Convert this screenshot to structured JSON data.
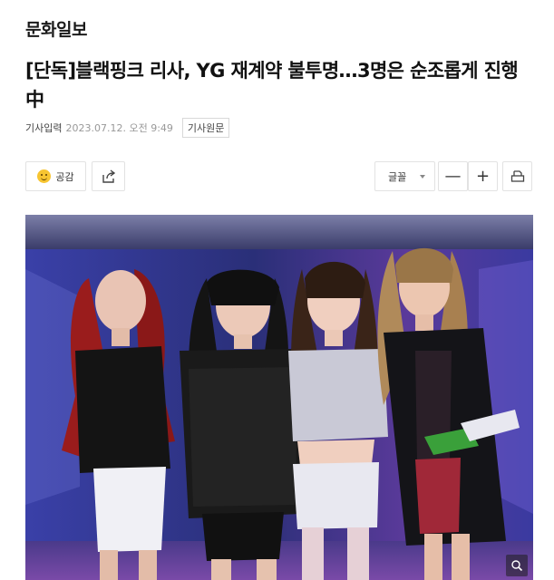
{
  "publisher": "문화일보",
  "headline": "[단독]블랙핑크 리사, YG 재계약 불투명…3명은 순조롭게 진행中",
  "meta": {
    "label": "기사입력",
    "datetime": "2023.07.12. 오전 9:49",
    "original_button": "기사원문"
  },
  "toolbar": {
    "like_label": "공감",
    "font_label": "글꼴",
    "minus_label": "—",
    "plus_label": "+",
    "icons": {
      "like": "smile-icon",
      "share": "share-icon",
      "font": "chevron-down-icon",
      "print": "print-icon",
      "zoom": "zoom-icon"
    }
  },
  "colors": {
    "like_icon": "#f7c531",
    "photo_bg": "#2a2f78",
    "border": "#e2e2e2"
  }
}
